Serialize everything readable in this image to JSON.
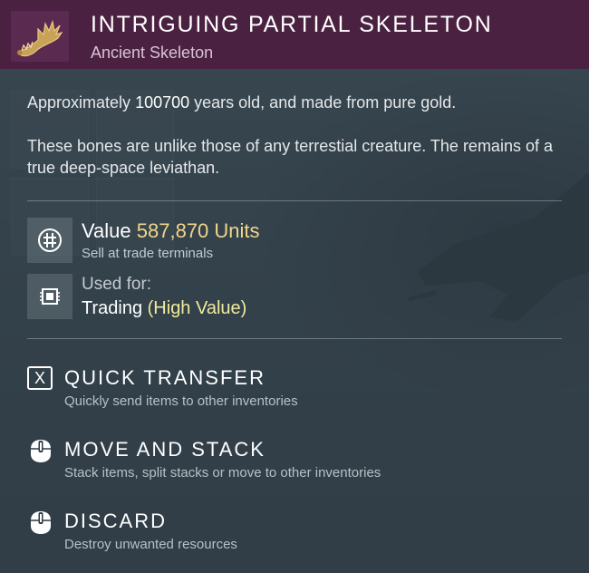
{
  "header": {
    "title": "INTRIGUING PARTIAL SKELETON",
    "subtitle": "Ancient Skeleton",
    "icon": "golden-skeleton-jaw-icon",
    "color": "#4b2142"
  },
  "description": {
    "line1_pre": "Approximately ",
    "line1_age": "100700",
    "line1_post": " years old, and made from pure gold.",
    "line2": "These bones are unlike those of any terrestial creature. The remains of a true deep-space leviathan."
  },
  "value": {
    "label": "Value ",
    "amount": "587,870 Units",
    "note": "Sell at trade terminals",
    "icon": "units-currency-icon"
  },
  "usage": {
    "label": "Used for:",
    "value_pre": "Trading ",
    "value_highlight": "(High Value)",
    "icon": "trade-chip-icon"
  },
  "actions": [
    {
      "title": "QUICK TRANSFER",
      "subtitle": "Quickly send items to other inventories",
      "icon": "x-key-icon",
      "key": "X"
    },
    {
      "title": "MOVE AND STACK",
      "subtitle": "Stack items, split stacks or move to other inventories",
      "icon": "mouse-left-button-icon"
    },
    {
      "title": "DISCARD",
      "subtitle": "Destroy unwanted resources",
      "icon": "mouse-button-icon"
    }
  ],
  "colors": {
    "accent": "#f1d58a",
    "highlight": "#f1ea9c"
  }
}
